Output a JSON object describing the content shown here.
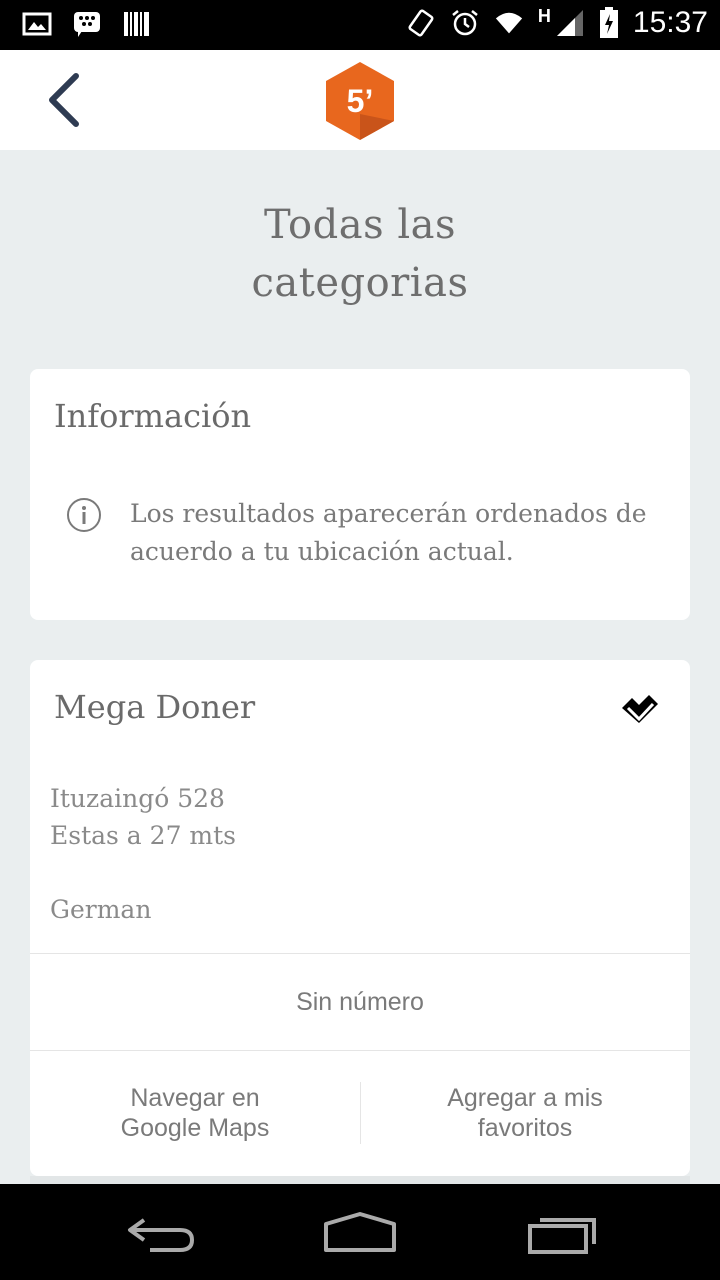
{
  "status_bar": {
    "time": "15:37",
    "network_type": "H",
    "icons": [
      "image-icon",
      "bbm-icon",
      "barcode-icon",
      "vibrate-icon",
      "alarm-icon",
      "wifi-icon",
      "signal-icon",
      "battery-charging-icon"
    ]
  },
  "app_bar": {
    "back_icon": "chevron-left-icon",
    "logo_text": "5’",
    "logo_color": "#e8671e"
  },
  "page": {
    "title_line1": "Todas las",
    "title_line2": "categorias"
  },
  "info_card": {
    "heading": "Información",
    "icon": "info-icon",
    "text": "Los resultados aparecerán ordenados de acuerdo a tu ubicación actual."
  },
  "place_card": {
    "name": "Mega Doner",
    "source_icon": "foursquare-icon",
    "address": "Ituzaingó 528",
    "distance": "Estas a 27 mts",
    "owner": "German",
    "phone_label": "Sin número",
    "navigate_label": "Navegar en Google Maps",
    "favorite_label": "Agregar a mis favoritos"
  },
  "nav_bar": {
    "icons": [
      "back-nav-icon",
      "home-nav-icon",
      "recents-nav-icon"
    ]
  }
}
